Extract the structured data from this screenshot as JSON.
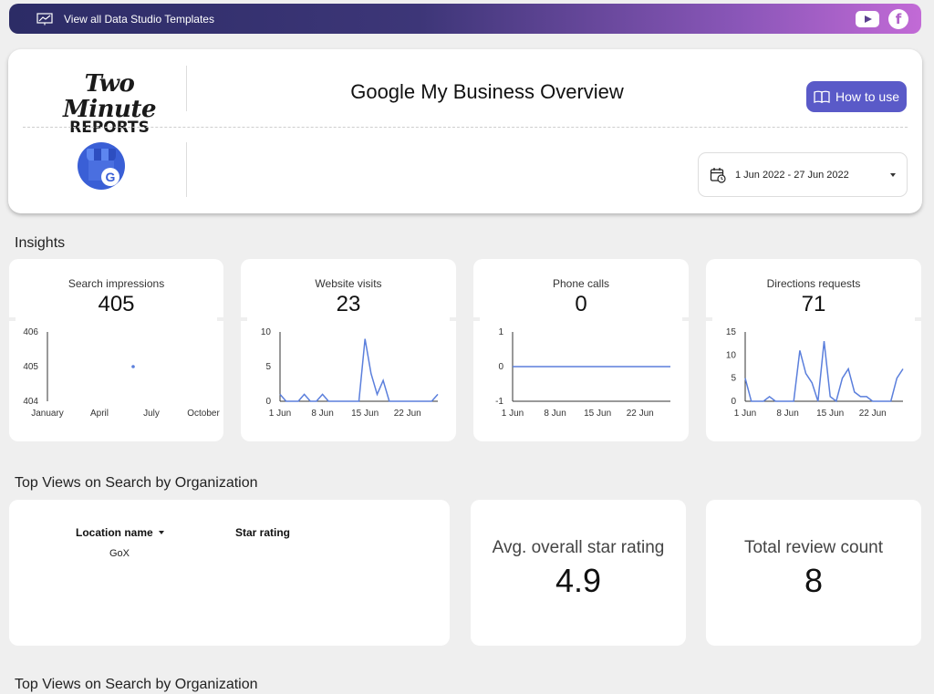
{
  "topbar": {
    "templates_link": "View all Data Studio Templates",
    "youtube_icon": "youtube-icon",
    "facebook_icon": "facebook-icon",
    "facebook_glyph": "f"
  },
  "header": {
    "logo_line1": "Two Minute",
    "logo_line2": "REPORTS",
    "title": "Google My Business Overview",
    "how_to_use": "How to use",
    "gmb_glyph": "G",
    "date_range": "1 Jun 2022 - 27 Jun 2022"
  },
  "sections": {
    "insights": "Insights",
    "top_views_1": "Top Views on Search by Organization",
    "top_views_2": "Top Views on Search by Organization"
  },
  "kpis": [
    {
      "name": "Search impressions",
      "value": "405"
    },
    {
      "name": "Website visits",
      "value": "23"
    },
    {
      "name": "Phone calls",
      "value": "0"
    },
    {
      "name": "Directions requests",
      "value": "71"
    }
  ],
  "chart_data": [
    {
      "type": "scatter",
      "x_ticks": [
        "January",
        "April",
        "July",
        "October"
      ],
      "y_ticks": [
        "404",
        "405",
        "406"
      ],
      "ylim": [
        404,
        406
      ],
      "points": [
        {
          "x": "June",
          "y": 405
        }
      ]
    },
    {
      "type": "line",
      "x": [
        "1 Jun",
        "2 Jun",
        "3 Jun",
        "4 Jun",
        "5 Jun",
        "6 Jun",
        "7 Jun",
        "8 Jun",
        "9 Jun",
        "10 Jun",
        "11 Jun",
        "12 Jun",
        "13 Jun",
        "14 Jun",
        "15 Jun",
        "16 Jun",
        "17 Jun",
        "18 Jun",
        "19 Jun",
        "20 Jun",
        "21 Jun",
        "22 Jun",
        "23 Jun",
        "24 Jun",
        "25 Jun",
        "26 Jun",
        "27 Jun"
      ],
      "x_ticks": [
        "1 Jun",
        "8 Jun",
        "15 Jun",
        "22 Jun"
      ],
      "y_ticks": [
        "0",
        "5",
        "10"
      ],
      "ylim": [
        0,
        10
      ],
      "values": [
        1,
        0,
        0,
        0,
        1,
        0,
        0,
        1,
        0,
        0,
        0,
        0,
        0,
        0,
        9,
        4,
        1,
        3,
        0,
        0,
        0,
        0,
        0,
        0,
        0,
        0,
        1
      ]
    },
    {
      "type": "line",
      "x": [
        "1 Jun",
        "2 Jun",
        "3 Jun",
        "4 Jun",
        "5 Jun",
        "6 Jun",
        "7 Jun",
        "8 Jun",
        "9 Jun",
        "10 Jun",
        "11 Jun",
        "12 Jun",
        "13 Jun",
        "14 Jun",
        "15 Jun",
        "16 Jun",
        "17 Jun",
        "18 Jun",
        "19 Jun",
        "20 Jun",
        "21 Jun",
        "22 Jun",
        "23 Jun",
        "24 Jun",
        "25 Jun",
        "26 Jun",
        "27 Jun"
      ],
      "x_ticks": [
        "1 Jun",
        "8 Jun",
        "15 Jun",
        "22 Jun"
      ],
      "y_ticks": [
        "-1",
        "0",
        "1"
      ],
      "ylim": [
        -1,
        1
      ],
      "values": [
        0,
        0,
        0,
        0,
        0,
        0,
        0,
        0,
        0,
        0,
        0,
        0,
        0,
        0,
        0,
        0,
        0,
        0,
        0,
        0,
        0,
        0,
        0,
        0,
        0,
        0,
        0
      ]
    },
    {
      "type": "line",
      "x": [
        "1 Jun",
        "2 Jun",
        "3 Jun",
        "4 Jun",
        "5 Jun",
        "6 Jun",
        "7 Jun",
        "8 Jun",
        "9 Jun",
        "10 Jun",
        "11 Jun",
        "12 Jun",
        "13 Jun",
        "14 Jun",
        "15 Jun",
        "16 Jun",
        "17 Jun",
        "18 Jun",
        "19 Jun",
        "20 Jun",
        "21 Jun",
        "22 Jun",
        "23 Jun",
        "24 Jun",
        "25 Jun",
        "26 Jun",
        "27 Jun"
      ],
      "x_ticks": [
        "1 Jun",
        "8 Jun",
        "15 Jun",
        "22 Jun"
      ],
      "y_ticks": [
        "0",
        "5",
        "10",
        "15"
      ],
      "ylim": [
        0,
        15
      ],
      "values": [
        5,
        0,
        0,
        0,
        1,
        0,
        0,
        0,
        0,
        11,
        6,
        4,
        0,
        13,
        1,
        0,
        5,
        7,
        2,
        1,
        1,
        0,
        0,
        0,
        0,
        5,
        7
      ]
    }
  ],
  "table": {
    "col1": "Location name",
    "col2": "Star rating",
    "rows": [
      {
        "location": "GoX",
        "rating": ""
      }
    ]
  },
  "scorecards": [
    {
      "label": "Avg. overall star rating",
      "value": "4.9"
    },
    {
      "label": "Total review count",
      "value": "8"
    }
  ],
  "colors": {
    "accent": "#5a5ac8",
    "line": "#5b7fdc"
  }
}
